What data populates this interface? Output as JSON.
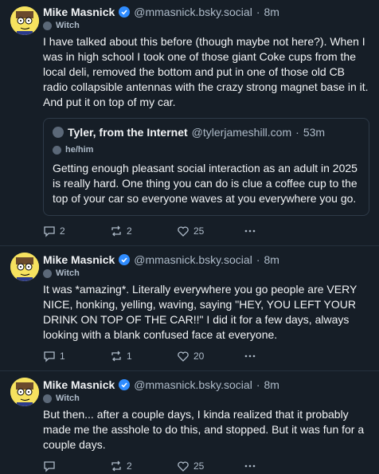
{
  "colors": {
    "background": "#161e27",
    "text": "#f1f3f5",
    "muted": "#aebbc9",
    "verified": "#2f8cff"
  },
  "posts": [
    {
      "author": "Mike Masnick",
      "handle": "@mmasnick.bsky.social",
      "time": "8m",
      "pronoun": "",
      "text": "I have talked about this before (though maybe not here?). When I was in high school I took one of those giant Coke cups from the local deli, removed the bottom and put in one of those old CB radio collapsible antennas with the crazy strong magnet base in it. And put it on top of my car.",
      "quote": {
        "author": "Tyler, from the Internet",
        "handle": "@tylerjameshill.com",
        "time": "53m",
        "pronoun": "he/him",
        "text": "Getting enough pleasant social interaction as an adult in 2025 is really hard. One thing you can do is clue a coffee cup to the top of your car so everyone waves at you everywhere you go."
      },
      "replies": "2",
      "reposts": "2",
      "likes": "25"
    },
    {
      "author": "Mike Masnick",
      "handle": "@mmasnick.bsky.social",
      "time": "8m",
      "pronoun": "Witch",
      "text": "It was *amazing*. Literally everywhere you go people are VERY NICE, honking, yelling, waving, saying \"HEY, YOU LEFT YOUR DRINK ON TOP OF THE CAR!!\" I did it for a few days, always looking with a blank confused face at everyone.",
      "replies": "1",
      "reposts": "1",
      "likes": "20"
    },
    {
      "author": "Mike Masnick",
      "handle": "@mmasnick.bsky.social",
      "time": "8m",
      "pronoun": "Witch",
      "text": "But then... after a couple days, I kinda realized that it probably made me the asshole to do this, and stopped. But it was fun for a couple days.",
      "replies": "",
      "reposts": "2",
      "likes": "25"
    }
  ],
  "first_post_pronoun": "Witch",
  "separator": "·"
}
